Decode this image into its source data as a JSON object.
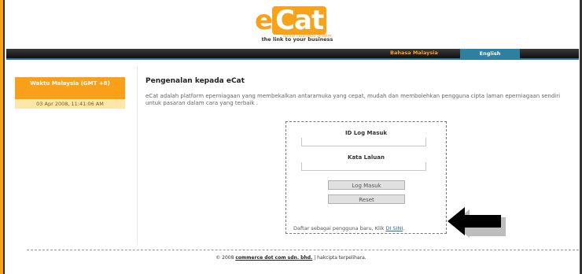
{
  "brand": {
    "logo_text": "eCat",
    "logo_subtext": "online catalogue system",
    "tagline": "the link to your business",
    "accent": "#f7a21b",
    "nav_blue": "#2f7f9f"
  },
  "nav": {
    "malay": "Bahasa Malaysia",
    "english": "English"
  },
  "time_panel": {
    "heading": "Waktu Malaysia (GMT +8)",
    "value": "03 Apr 2008, 11:41:06 AM"
  },
  "main": {
    "title": "Pengenalan kepada eCat",
    "intro": "eCat adalah platform eperniagaan yang membekalkan antaramuka yang cepat, mudah dan membolehkan pengguna cipta laman eperniagaan sendiri untuk pasaran dalam cara yang terbaik ."
  },
  "login": {
    "id_label": "ID Log Masuk",
    "id_value": "",
    "password_label": "Kata Laluan",
    "password_value": "",
    "login_button": "Log Masuk",
    "reset_button": "Reset",
    "register_text": "Daftar sebagai pengguna baru, Klik ",
    "register_link": "DI SINI",
    "register_end": "."
  },
  "footer": {
    "copyright_prefix": "© 2008 ",
    "company": "commerce dot com sdn. bhd.",
    "rights": " | hakcipta terpelihara."
  },
  "icons": {
    "arrow": "left-arrow-icon"
  }
}
